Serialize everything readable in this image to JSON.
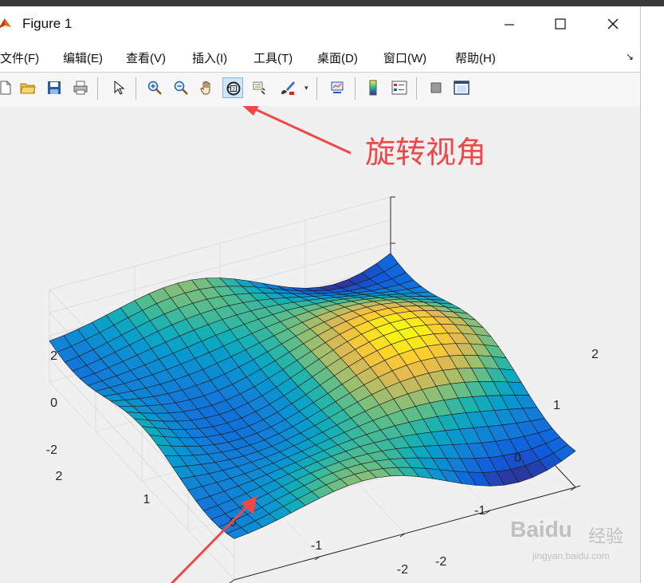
{
  "window": {
    "title": "Figure 1"
  },
  "menu": [
    {
      "label": "文件(F)"
    },
    {
      "label": "编辑(E)"
    },
    {
      "label": "查看(V)"
    },
    {
      "label": "插入(I)"
    },
    {
      "label": "工具(T)"
    },
    {
      "label": "桌面(D)"
    },
    {
      "label": "窗口(W)"
    },
    {
      "label": "帮助(H)"
    }
  ],
  "toolbar": {
    "buttons": [
      {
        "icon": "new-file-icon"
      },
      {
        "icon": "open-folder-icon"
      },
      {
        "icon": "save-icon"
      },
      {
        "icon": "print-icon"
      },
      {
        "icon": "pointer-icon"
      },
      {
        "icon": "zoom-in-icon"
      },
      {
        "icon": "zoom-out-icon"
      },
      {
        "icon": "pan-hand-icon"
      },
      {
        "icon": "rotate-3d-icon",
        "active": true
      },
      {
        "icon": "data-cursor-icon"
      },
      {
        "icon": "brush-icon"
      },
      {
        "icon": "link-plot-icon"
      },
      {
        "icon": "colorbar-icon"
      },
      {
        "icon": "legend-icon"
      },
      {
        "icon": "hide-tools-icon"
      },
      {
        "icon": "show-tools-icon"
      }
    ]
  },
  "annotation": {
    "text": "旋转视角",
    "color": "#f04848"
  },
  "watermark": {
    "logo": "Baidu",
    "cn": "经验",
    "url": "jingyan.baidu.com"
  },
  "chart_data": {
    "type": "surface",
    "z_ticks": [
      "2",
      "0",
      "-2"
    ],
    "x_ticks": [
      "2",
      "1",
      "0",
      "-1",
      "-2"
    ],
    "y_ticks": [
      "2",
      "1",
      "0",
      "-1",
      "-2"
    ],
    "xlim": [
      -2,
      2
    ],
    "ylim": [
      -2,
      2
    ],
    "zlim": [
      -2,
      2
    ],
    "colormap": "parula",
    "grid": true
  }
}
